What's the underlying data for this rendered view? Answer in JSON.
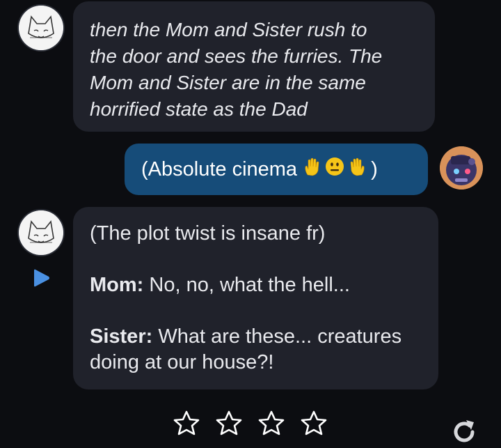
{
  "messages": [
    {
      "sender": "bot",
      "lines": [
        "then the Mom and Sister rush to",
        "the door and sees the furries. The",
        "Mom and Sister are in the same",
        "horrified state as the Dad"
      ]
    },
    {
      "sender": "user",
      "text_before": "(Absolute cinema ",
      "emojis": [
        "raised-hand",
        "neutral-face",
        "raised-back-of-hand"
      ],
      "text_after": ")"
    },
    {
      "sender": "bot",
      "intro": "(The plot twist is insane fr)",
      "dialogue": [
        {
          "speaker": "Mom:",
          "text": " No, no, what the hell..."
        },
        {
          "speaker": "Sister:",
          "text": " What are these... creatures",
          "text2": "doing at our house?!"
        }
      ]
    }
  ],
  "rating": {
    "stars": 4,
    "icon": "star-outline-icon"
  },
  "colors": {
    "bot_bubble": "#20222b",
    "user_bubble": "#164c79",
    "accent": "#4a90e2"
  }
}
